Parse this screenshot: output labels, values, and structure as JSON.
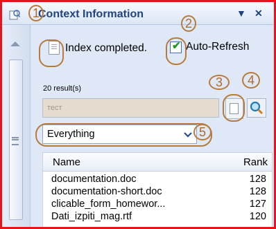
{
  "header": {
    "title": "Context Information",
    "menu_glyph": "▼",
    "close_glyph": "✕",
    "icon": "context-information-icon"
  },
  "status": {
    "text": "Index completed.",
    "icon": "document-icon"
  },
  "auto_refresh": {
    "label": "Auto-Refresh",
    "checked": true,
    "check_glyph": "✔"
  },
  "results_count": "20 result(s)",
  "search": {
    "value": "тест",
    "placeholder": "тест"
  },
  "buttons": {
    "context_button_icon": "document-icon",
    "search_button_icon": "search-icon"
  },
  "scope": {
    "selected": "Everything",
    "arrow_glyph": "❯"
  },
  "table": {
    "columns": [
      "Name",
      "Rank"
    ],
    "rows": [
      {
        "name": "documentation.doc",
        "rank": "128"
      },
      {
        "name": "documentation-short.doc",
        "rank": "128"
      },
      {
        "name": "clicable_form_homewor...",
        "rank": "127"
      },
      {
        "name": "Dati_izpiti_mag.rtf",
        "rank": "120"
      }
    ]
  },
  "callouts": [
    "1",
    "2",
    "3",
    "4",
    "5"
  ],
  "colors": {
    "frame": "#e8141c",
    "accent": "#21437f",
    "callout": "#b87a3a",
    "check": "#1b9a1b"
  }
}
